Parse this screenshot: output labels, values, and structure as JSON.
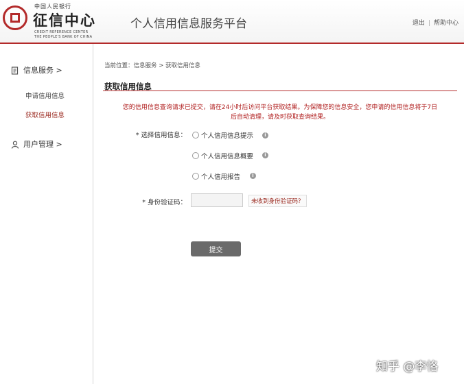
{
  "header": {
    "logo_top": "中国人民银行",
    "logo_main": "征信中心",
    "logo_en_line1": "CREDIT REFERENCE CENTER",
    "logo_en_line2": "THE PEOPLE'S BANK OF CHINA",
    "platform_title": "个人信用信息服务平台",
    "logout": "退出",
    "help": "帮助中心"
  },
  "sidebar": {
    "credit_service": "信息服务 >",
    "apply_credit": "申请信用信息",
    "get_credit": "获取信用信息",
    "user_management": "用户管理 >"
  },
  "main": {
    "breadcrumb": "当前位置：信息服务 > 获取信用信息",
    "section_title": "获取信用信息",
    "notice_line1": "您的信用信息查询请求已提交，请在24小时后访问平台获取结果。为保障您的信息安全，您申请的信用信息将于7日",
    "notice_line2": "后自动清理，请及时获取查询结果。",
    "select_label": "* 选择信用信息：",
    "options": [
      "个人信用信息提示",
      "个人信用信息概要",
      "个人信用报告"
    ],
    "id_code_label": "* 身份验证码：",
    "id_code_value": "",
    "not_received_link": "未收到身份验证码？",
    "submit": "提交"
  },
  "watermark": "知乎 @李恪",
  "colors": {
    "accent": "#b32a2a",
    "notice": "#b01e1e",
    "button": "#6a6a6a"
  }
}
